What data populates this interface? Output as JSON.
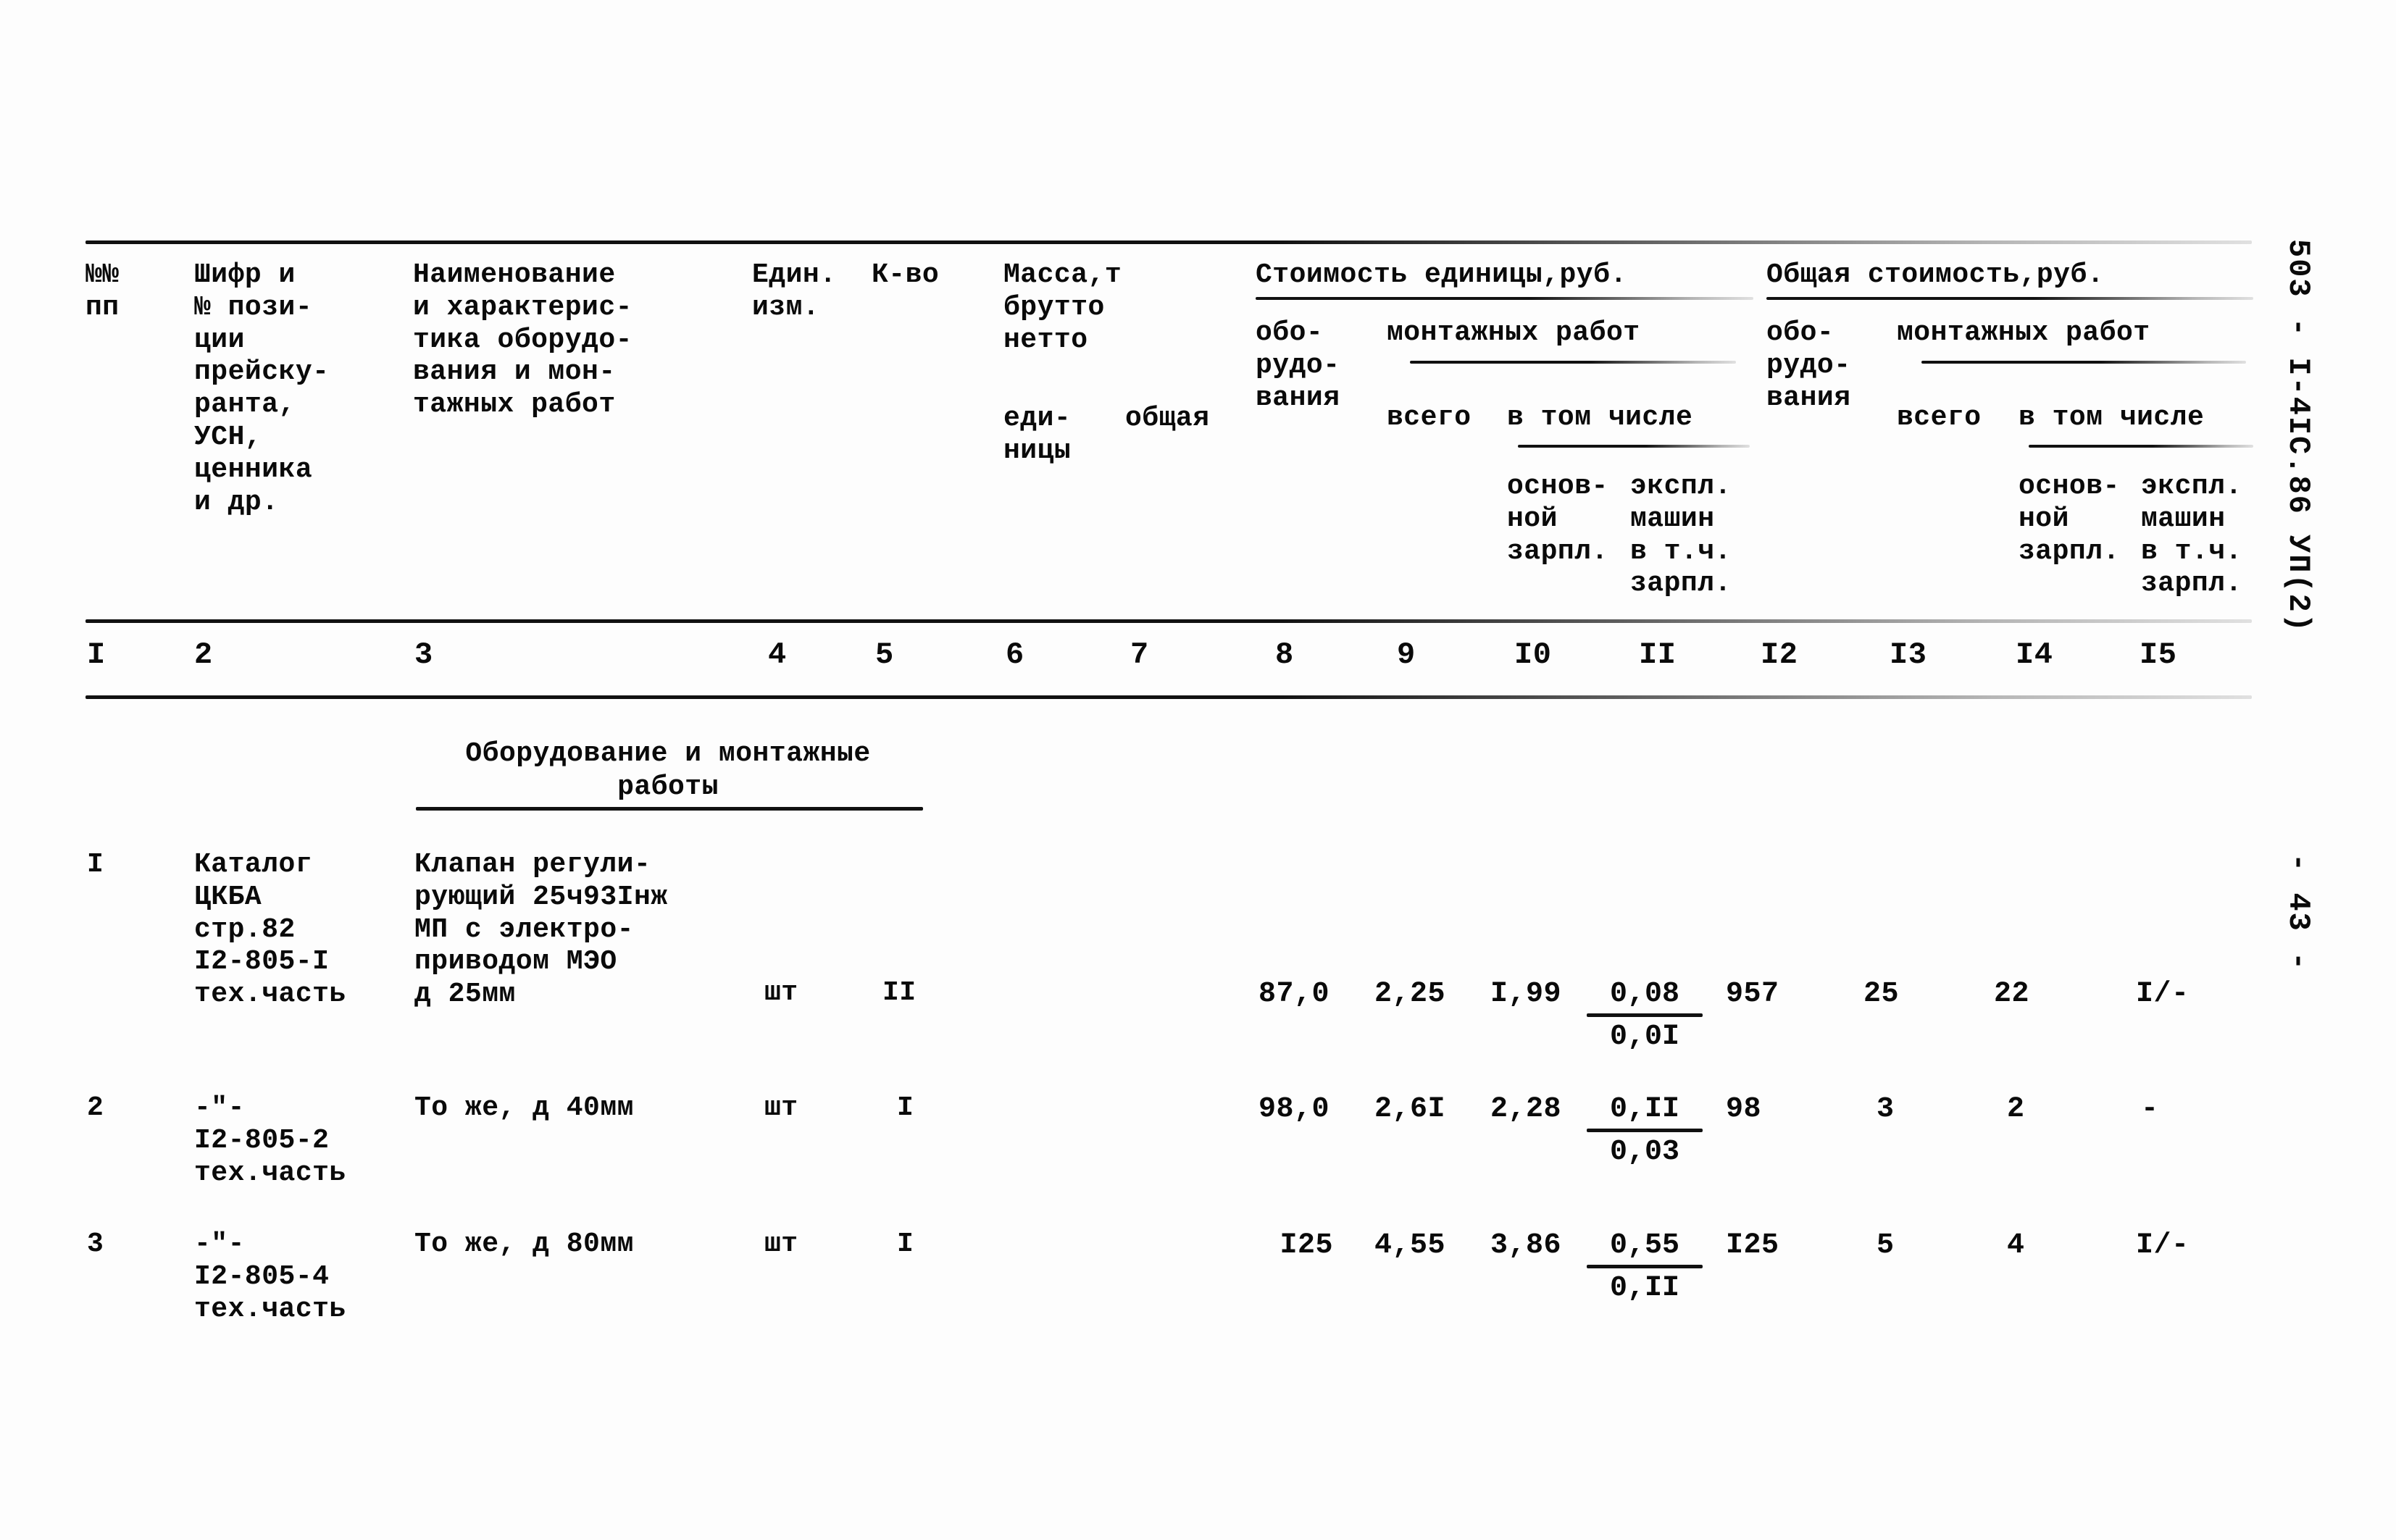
{
  "document": {
    "sheet_code": "503 - I-4IC.86  УП(2)",
    "page_number": "- 43 -"
  },
  "table": {
    "header": {
      "col1": "№№\nпп",
      "col2": "Шифр и\n№ пози-\nции\nпрейску-\nранта,\nУСН,\nценника\nи др.",
      "col3": "Наименование\nи характерис-\nтика оборудо-\nвания и мон-\nтажных работ",
      "col4": "Един.\nизм.",
      "col5": "К-во",
      "col6_group": "Масса,т\nбрутто\nнетто",
      "col6": "еди-\nницы",
      "col7": "общая",
      "group_unit_cost": "Стоимость единицы,руб.",
      "group_total_cost": "Общая стоимость,руб.",
      "unit_equipment": "обо-\nрудо-\nвания",
      "unit_install_group": "монтажных работ",
      "unit_install_all": "всего",
      "unit_install_incl": "в том числе",
      "unit_incl_base": "основ-\nной\nзарпл.",
      "unit_incl_mach": "экспл.\nмашин\nв т.ч.\nзарпл.",
      "total_equipment": "обо-\nрудо-\nвания",
      "total_install_group": "монтажных работ",
      "total_install_all": "всего",
      "total_install_incl": "в том числе",
      "total_incl_base": "основ-\nной\nзарпл.",
      "total_incl_mach": "экспл.\nмашин\nв т.ч.\nзарпл."
    },
    "column_numbers": [
      "I",
      "2",
      "3",
      "4",
      "5",
      "6",
      "7",
      "8",
      "9",
      "I0",
      "II",
      "I2",
      "I3",
      "I4",
      "I5"
    ],
    "section_title": "Оборудование и монтажные\nработы",
    "rows": [
      {
        "no": "I",
        "code": "Каталог\nЦКБА\nстр.82\nI2-805-I\nтех.часть",
        "name": "Клапан регули-\nрующий 25ч93Iнж\nМП с электро-\nприводом МЭО\nд 25мм",
        "unit": "шт",
        "qty": "II",
        "mass_unit": "",
        "mass_total": "",
        "unit_equipment": "87,0",
        "unit_install_all": "2,25",
        "unit_incl_base": "I,99",
        "unit_incl_mach_num": "0,08",
        "unit_incl_mach_den": "0,0I",
        "total_equipment": "957",
        "total_install_all": "25",
        "total_incl_base": "22",
        "total_incl_mach": "I/-"
      },
      {
        "no": "2",
        "code": "-\"-\nI2-805-2\nтех.часть",
        "name": "То же, д 40мм",
        "unit": "шт",
        "qty": "I",
        "mass_unit": "",
        "mass_total": "",
        "unit_equipment": "98,0",
        "unit_install_all": "2,6I",
        "unit_incl_base": "2,28",
        "unit_incl_mach_num": "0,II",
        "unit_incl_mach_den": "0,03",
        "total_equipment": "98",
        "total_install_all": "3",
        "total_incl_base": "2",
        "total_incl_mach": "-"
      },
      {
        "no": "3",
        "code": "-\"-\nI2-805-4\nтех.часть",
        "name": "То же, д 80мм",
        "unit": "шт",
        "qty": "I",
        "mass_unit": "",
        "mass_total": "",
        "unit_equipment": "I25",
        "unit_install_all": "4,55",
        "unit_incl_base": "3,86",
        "unit_incl_mach_num": "0,55",
        "unit_incl_mach_den": "0,II",
        "total_equipment": "I25",
        "total_install_all": "5",
        "total_incl_base": "4",
        "total_incl_mach": "I/-"
      }
    ]
  }
}
